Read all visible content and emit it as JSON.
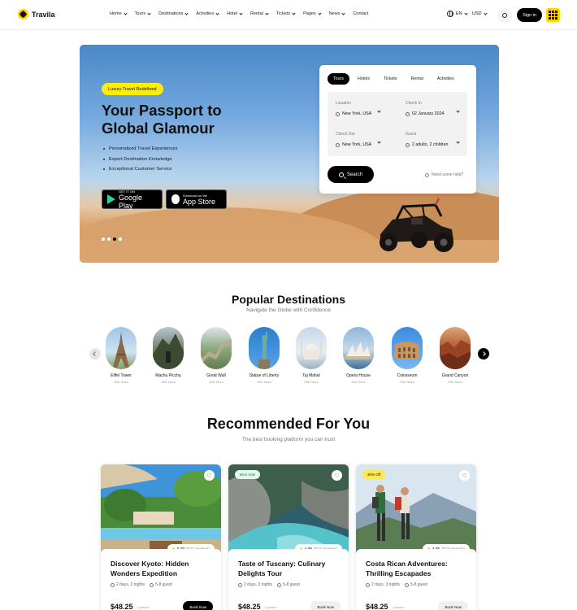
{
  "brand": {
    "name": "Travila"
  },
  "nav": {
    "items": [
      {
        "label": "Home",
        "dropdown": true
      },
      {
        "label": "Tours",
        "dropdown": true
      },
      {
        "label": "Destinations",
        "dropdown": true
      },
      {
        "label": "Activities",
        "dropdown": true
      },
      {
        "label": "Hotel",
        "dropdown": true
      },
      {
        "label": "Rental",
        "dropdown": true
      },
      {
        "label": "Tickets",
        "dropdown": true
      },
      {
        "label": "Pages",
        "dropdown": true
      },
      {
        "label": "News",
        "dropdown": true
      },
      {
        "label": "Contact",
        "dropdown": false
      }
    ],
    "language": "EN",
    "currency": "USD",
    "signin_label": "Sign in"
  },
  "hero": {
    "badge": "Luxury Travel Redefined",
    "title": "Your Passport to Global Glamour",
    "bullets": [
      "Personalized Travel Experiences",
      "Expert Destination Knowledge",
      "Exceptional Customer Service"
    ],
    "google_play": {
      "small": "GET IT ON",
      "big": "Google Play"
    },
    "app_store": {
      "small": "Download on the",
      "big": "App Store"
    },
    "slides_total": 4,
    "slide_active": 3
  },
  "search": {
    "tabs": [
      "Tours",
      "Hotels",
      "Tickets",
      "Rental",
      "Activities"
    ],
    "active_tab": "Tours",
    "fields": {
      "location": {
        "label": "Location",
        "value": "New York, USA"
      },
      "checkin": {
        "label": "Check In",
        "value": "02 January 2024"
      },
      "checkout": {
        "label": "Check Out",
        "value": "New York, USA"
      },
      "guest": {
        "label": "Guest",
        "value": "2 adults, 2 children"
      }
    },
    "button_label": "Search",
    "help_text": "Need some help?"
  },
  "popular": {
    "title": "Popular Destinations",
    "subtitle": "Navigate the Globe with Confidence",
    "destinations": [
      {
        "name": "Eiffel Tower",
        "tours": "356 Tours"
      },
      {
        "name": "Machu Picchu",
        "tours": "356 Tours"
      },
      {
        "name": "Great Wall",
        "tours": "356 Tours"
      },
      {
        "name": "Statue of Liberty",
        "tours": "356 Tours"
      },
      {
        "name": "Taj Mahal",
        "tours": "356 Tours"
      },
      {
        "name": "Opera House",
        "tours": "356 Tours"
      },
      {
        "name": "Colosseum",
        "tours": "356 Tours"
      },
      {
        "name": "Grand Canyon",
        "tours": "356 Tours"
      }
    ]
  },
  "recommended": {
    "title": "Recommended For You",
    "subtitle": "The best booking platform you can trust",
    "cards": [
      {
        "badge": "",
        "rating": "5.00",
        "reviews": "(672 reviews)",
        "title": "Discover Kyoto: Hidden Wonders Expedition",
        "duration": "2 days, 3 nights",
        "guests": "5-8 guest",
        "price": "$48.25",
        "price_note": "/ person",
        "book_label": "Book Now"
      },
      {
        "badge": "Best Sale",
        "rating": "4.95",
        "reviews": "(672 reviews)",
        "title": "Taste of Tuscany: Culinary Delights Tour",
        "duration": "2 days, 3 nights",
        "guests": "5-8 guest",
        "price": "$48.25",
        "price_note": "/ person",
        "book_label": "Book Now"
      },
      {
        "badge": "30% Off",
        "rating": "4.95",
        "reviews": "(672 reviews)",
        "title": "Costa Rican Adventures: Thrilling Escapades",
        "duration": "2 days, 3 nights",
        "guests": "5-8 guest",
        "price": "$48.25",
        "price_note": "/ person",
        "book_label": "Book Now"
      }
    ]
  },
  "colors": {
    "accent": "#FFD400",
    "badge_yellow": "#FFEE00",
    "dark": "#000000",
    "best_sale": "#E6F7EC"
  }
}
